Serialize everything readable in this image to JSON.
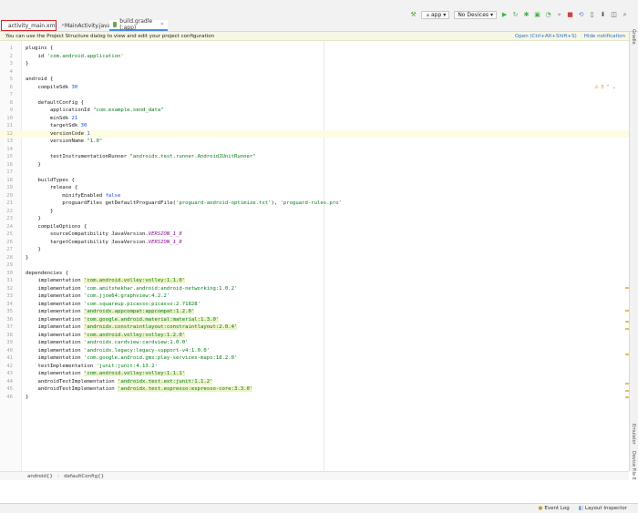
{
  "tabs": [
    {
      "label": "activity_main.xml",
      "color": "#e8833a"
    },
    {
      "label": "MainActivity.java",
      "color": "#4a8ee0"
    },
    {
      "label": "build.gradle (:app)",
      "color": "#6aa84f"
    }
  ],
  "toolbar": {
    "config": "app",
    "device": "No Devices"
  },
  "notification": {
    "message": "You can use the Project Structure dialog to view and edit your project configuration",
    "open_link": "Open (Ctrl+Alt+Shift+S)",
    "hide_link": "Hide notification"
  },
  "editor": {
    "warning_count": "5",
    "current_line": 12,
    "lines": [
      [
        [
          "t",
          "plugins {"
        ]
      ],
      [
        [
          "t",
          "    id "
        ],
        [
          "s",
          "'com.android.application'"
        ]
      ],
      [
        [
          "t",
          "}"
        ]
      ],
      [
        [
          "t",
          ""
        ]
      ],
      [
        [
          "t",
          "android {"
        ]
      ],
      [
        [
          "t",
          "    compileSdk "
        ],
        [
          "n",
          "30"
        ]
      ],
      [
        [
          "t",
          ""
        ]
      ],
      [
        [
          "t",
          "    defaultConfig {"
        ]
      ],
      [
        [
          "t",
          "        applicationId "
        ],
        [
          "s",
          "\"com.example.send_data\""
        ]
      ],
      [
        [
          "t",
          "        minSdk "
        ],
        [
          "n",
          "21"
        ]
      ],
      [
        [
          "t",
          "        targetSdk "
        ],
        [
          "n",
          "30"
        ]
      ],
      [
        [
          "t",
          "        versionCode "
        ],
        [
          "n",
          "1"
        ]
      ],
      [
        [
          "t",
          "        versionName "
        ],
        [
          "s",
          "\"1.0\""
        ]
      ],
      [
        [
          "t",
          ""
        ]
      ],
      [
        [
          "t",
          "        testInstrumentationRunner "
        ],
        [
          "s",
          "\"androidx.test.runner.AndroidJUnitRunner\""
        ]
      ],
      [
        [
          "t",
          "    }"
        ]
      ],
      [
        [
          "t",
          ""
        ]
      ],
      [
        [
          "t",
          "    buildTypes {"
        ]
      ],
      [
        [
          "t",
          "        release {"
        ]
      ],
      [
        [
          "t",
          "            minifyEnabled "
        ],
        [
          "n",
          "false"
        ]
      ],
      [
        [
          "t",
          "            proguardFiles getDefaultProguardFile("
        ],
        [
          "s",
          "'proguard-android-optimize.txt'"
        ],
        [
          "t",
          "), "
        ],
        [
          "s",
          "'proguard-rules.pro'"
        ]
      ],
      [
        [
          "t",
          "        }"
        ]
      ],
      [
        [
          "t",
          "    }"
        ]
      ],
      [
        [
          "t",
          "    compileOptions {"
        ]
      ],
      [
        [
          "t",
          "        sourceCompatibility JavaVersion."
        ],
        [
          "i",
          "VERSION_1_8"
        ]
      ],
      [
        [
          "t",
          "        targetCompatibility JavaVersion."
        ],
        [
          "i",
          "VERSION_1_8"
        ]
      ],
      [
        [
          "t",
          "    }"
        ]
      ],
      [
        [
          "t",
          "}"
        ]
      ],
      [
        [
          "t",
          ""
        ]
      ],
      [
        [
          "t",
          "dependencies {"
        ]
      ],
      [
        [
          "t",
          "    implementation "
        ],
        [
          "h",
          "'com.android.volley:volley:1.1.0'"
        ]
      ],
      [
        [
          "t",
          "    implementation "
        ],
        [
          "s",
          "'com.amitshekhar.android:android-networking:1.0.2'"
        ]
      ],
      [
        [
          "t",
          "    implementation "
        ],
        [
          "s",
          "'com.jjoe64:graphview:4.2.2'"
        ]
      ],
      [
        [
          "t",
          "    implementation "
        ],
        [
          "s",
          "'com.squareup.picasso:picasso:2.71828'"
        ]
      ],
      [
        [
          "t",
          "    implementation "
        ],
        [
          "h",
          "'androidx.appcompat:appcompat:1.2.0'"
        ]
      ],
      [
        [
          "t",
          "    implementation "
        ],
        [
          "h",
          "'com.google.android.material:material:1.3.0'"
        ]
      ],
      [
        [
          "t",
          "    implementation "
        ],
        [
          "h",
          "'androidx.constraintlayout:constraintlayout:2.0.4'"
        ]
      ],
      [
        [
          "t",
          "    implementation "
        ],
        [
          "h",
          "'com.android.volley:volley:1.2.0'"
        ]
      ],
      [
        [
          "t",
          "    implementation "
        ],
        [
          "s",
          "'androidx.cardview:cardview:1.0.0'"
        ]
      ],
      [
        [
          "t",
          "    implementation "
        ],
        [
          "s",
          "'androidx.legacy:legacy-support-v4:1.0.0'"
        ]
      ],
      [
        [
          "t",
          "    implementation "
        ],
        [
          "s",
          "'com.google.android.gms:play-services-maps:18.2.0'"
        ]
      ],
      [
        [
          "t",
          "    testImplementation "
        ],
        [
          "s",
          "'junit:junit:4.13.2'"
        ]
      ],
      [
        [
          "t",
          "    implementation "
        ],
        [
          "h",
          "'com.android.volley:volley:1.1.1'"
        ]
      ],
      [
        [
          "t",
          "    androidTestImplementation "
        ],
        [
          "h",
          "'androidx.test.ext:junit:1.1.2'"
        ]
      ],
      [
        [
          "t",
          "    androidTestImplementation "
        ],
        [
          "h",
          "'androidx.test.espresso:espresso-core:3.3.0'"
        ]
      ],
      [
        [
          "t",
          "}"
        ]
      ]
    ]
  },
  "right_panels": {
    "gradle": "Gradle",
    "emulator": "Emulator",
    "device_explorer": "Device File Explorer"
  },
  "breadcrumb": {
    "part1": "android{}",
    "part2": "defaultConfig{}"
  },
  "status": {
    "event_log": "Event Log",
    "layout_inspector": "Layout Inspector"
  },
  "colors": {
    "string": "#067d17",
    "number": "#1750eb",
    "constant": "#871094",
    "active_tab_border": "#d9262b"
  }
}
